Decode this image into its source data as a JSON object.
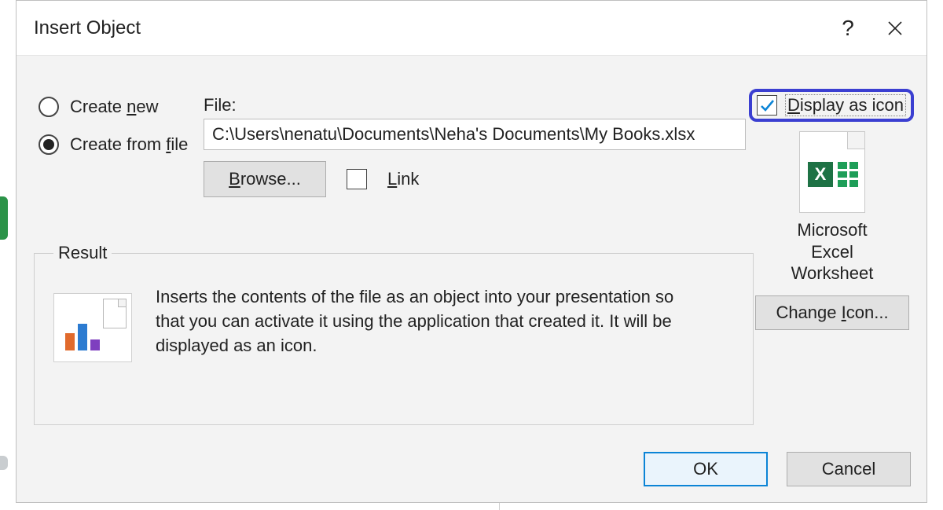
{
  "dialog": {
    "title": "Insert Object",
    "help_tooltip": "?",
    "close_tooltip": "Close"
  },
  "radios": {
    "create_new": "Create new",
    "create_from_file": "Create from file",
    "selected": "create_from_file"
  },
  "file": {
    "label": "File:",
    "path": "C:\\Users\\nenatu\\Documents\\Neha's Documents\\My Books.xlsx",
    "browse": "Browse...",
    "link_label": "Link",
    "link_checked": false
  },
  "display_as_icon": {
    "label": "Display as icon",
    "checked": true
  },
  "icon_preview": {
    "caption_line1": "Microsoft",
    "caption_line2": "Excel",
    "caption_line3": "Worksheet",
    "change_icon": "Change Icon..."
  },
  "result": {
    "legend": "Result",
    "text": "Inserts the contents of the file as an object into your presentation so that you can activate it using the application that created it. It will be displayed as an icon."
  },
  "buttons": {
    "ok": "OK",
    "cancel": "Cancel"
  }
}
